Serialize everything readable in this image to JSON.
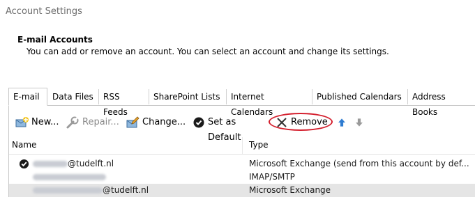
{
  "window": {
    "title": "Account Settings"
  },
  "section": {
    "title": "E-mail Accounts",
    "description": "You can add or remove an account. You can select an account and change its settings."
  },
  "tabs": [
    {
      "label": "E-mail",
      "active": true
    },
    {
      "label": "Data Files"
    },
    {
      "label": "RSS Feeds"
    },
    {
      "label": "SharePoint Lists"
    },
    {
      "label": "Internet Calendars"
    },
    {
      "label": "Published Calendars"
    },
    {
      "label": "Address Books"
    }
  ],
  "toolbar": {
    "new_label": "New...",
    "repair_label": "Repair...",
    "change_label": "Change...",
    "set_default_label": "Set as Default",
    "remove_label": "Remove",
    "move_up_icon": "arrow-up-icon",
    "move_down_icon": "arrow-down-icon",
    "highlight_color": "#d4202e"
  },
  "list": {
    "columns": {
      "name": "Name",
      "type": "Type"
    },
    "rows": [
      {
        "name_suffix": "@tudelft.nl",
        "type": "Microsoft Exchange (send from this account by def...",
        "default": true
      },
      {
        "name_suffix": "",
        "type": "IMAP/SMTP",
        "default": false
      },
      {
        "name_suffix": "@tudelft.nl",
        "type": "Microsoft Exchange",
        "default": false,
        "selected": true
      }
    ]
  }
}
